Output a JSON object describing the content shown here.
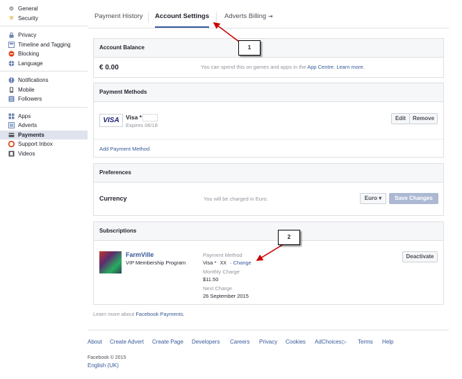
{
  "sidebar": {
    "groups": [
      [
        {
          "icon": "gear-icon",
          "label": "General"
        },
        {
          "icon": "shield-icon",
          "label": "Security"
        }
      ],
      [
        {
          "icon": "lock-icon",
          "label": "Privacy"
        },
        {
          "icon": "timeline-icon",
          "label": "Timeline and Tagging"
        },
        {
          "icon": "blocking-icon",
          "label": "Blocking"
        },
        {
          "icon": "globe-icon",
          "label": "Language"
        }
      ],
      [
        {
          "icon": "notifications-icon",
          "label": "Notifications"
        },
        {
          "icon": "mobile-icon",
          "label": "Mobile"
        },
        {
          "icon": "followers-icon",
          "label": "Followers"
        }
      ],
      [
        {
          "icon": "apps-icon",
          "label": "Apps"
        },
        {
          "icon": "adverts-icon",
          "label": "Adverts"
        },
        {
          "icon": "payments-icon",
          "label": "Payments",
          "active": true
        },
        {
          "icon": "support-inbox-icon",
          "label": "Support Inbox"
        },
        {
          "icon": "videos-icon",
          "label": "Videos"
        }
      ]
    ]
  },
  "tabs": {
    "payment_history": "Payment History",
    "account_settings": "Account Settings",
    "adverts_billing": "Adverts Billing"
  },
  "account_balance": {
    "title": "Account Balance",
    "amount": "€ 0.00",
    "note": "You can spend this on games and apps in the",
    "app_centre": "App Centre",
    "learn_more": "Learn more."
  },
  "payment_methods": {
    "title": "Payment Methods",
    "card_logo": "VISA",
    "card_name": "Visa *",
    "expires": "Expires 06/18",
    "edit": "Edit",
    "remove": "Remove",
    "add": "Add Payment Method"
  },
  "preferences": {
    "title": "Preferences",
    "currency_label": "Currency",
    "currency_note": "You will be charged in Euro.",
    "currency_value": "Euro",
    "save": "Save Changes"
  },
  "subscriptions": {
    "title": "Subscriptions",
    "app_name": "FarmVille",
    "plan": "VIP Membership Program",
    "pm_label": "Payment Method",
    "pm_value": "Visa *",
    "pm_masked": "XX",
    "change": "Change",
    "monthly_label": "Monthly Charge",
    "monthly_value": "$11.50",
    "next_label": "Next Charge",
    "next_value": "26 September 2015",
    "deactivate": "Deactivate"
  },
  "learn_more_text": "Learn more about",
  "fb_payments": "Facebook Payments.",
  "annotations": {
    "one": "1",
    "two": "2"
  },
  "footer": {
    "links": [
      "About",
      "Create Advert",
      "Create Page",
      "Developers",
      "Careers",
      "Privacy",
      "Cookies",
      "AdChoices",
      "Terms",
      "Help"
    ],
    "copyright": "Facebook © 2015",
    "language": "English (UK)"
  }
}
